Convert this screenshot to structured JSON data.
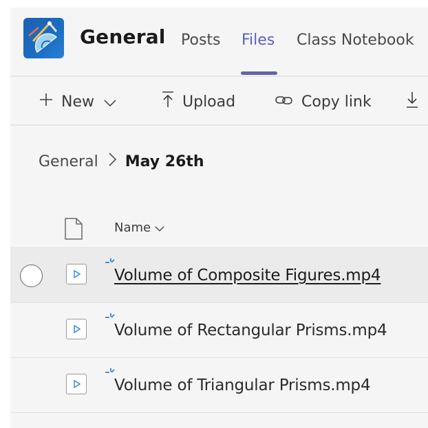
{
  "header": {
    "channel_title": "General",
    "tabs": [
      {
        "label": "Posts",
        "active": false
      },
      {
        "label": "Files",
        "active": true
      },
      {
        "label": "Class Notebook",
        "active": false
      }
    ]
  },
  "toolbar": {
    "new_label": "New",
    "upload_label": "Upload",
    "copy_link_label": "Copy link",
    "icons": [
      "plus-icon",
      "chevron-down-icon",
      "upload-icon",
      "link-icon",
      "download-icon"
    ]
  },
  "breadcrumb": {
    "root": "General",
    "current": "May 26th"
  },
  "file_list": {
    "name_column": "Name",
    "files": [
      {
        "name": "Volume of Composite Figures.mp4",
        "type": "video",
        "new": true
      },
      {
        "name": "Volume of Rectangular Prisms.mp4",
        "type": "video",
        "new": true
      },
      {
        "name": "Volume of Triangular Prisms.mp4",
        "type": "video",
        "new": true
      }
    ]
  },
  "colors": {
    "accent": "#5b5fc7",
    "tab_underline": "#6264a7",
    "new_marker": "#2b88d8",
    "team_logo": "#1b6ec2"
  }
}
